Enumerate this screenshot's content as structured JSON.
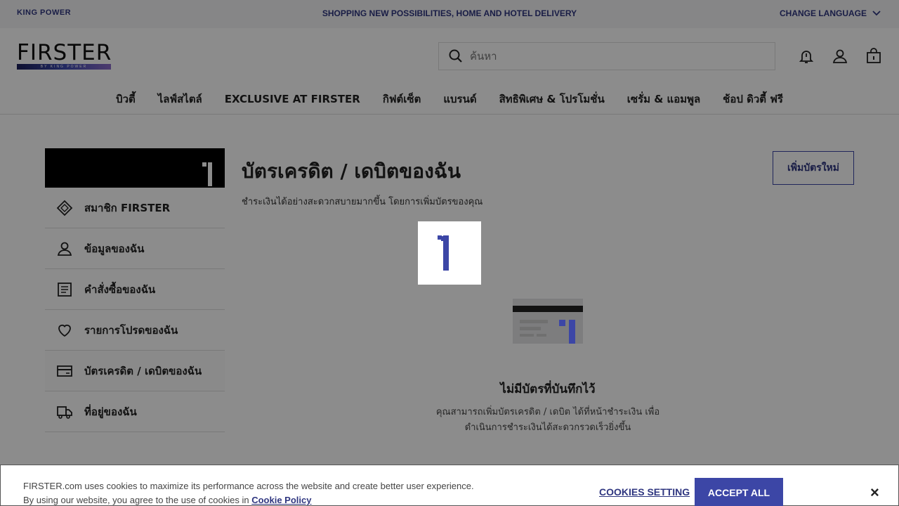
{
  "topbar": {
    "logo": "KING POWER",
    "promo": "SHOPPING NEW POSSIBILITIES, HOME AND HOTEL DELIVERY",
    "language": "CHANGE LANGUAGE"
  },
  "header": {
    "logo": "FIRSTER",
    "logo_sub": "BY KING POWER",
    "search_placeholder": "ค้นหา"
  },
  "nav": [
    "บิวตี้",
    "ไลฟ์สไตล์",
    "EXCLUSIVE AT FIRSTER",
    "กิฟต์เซ็ต",
    "แบรนด์",
    "สิทธิพิเศษ & โปรโมชั่น",
    "เซรั่ม & แอมพูล",
    "ช้อป ดิวตี้ ฟรี"
  ],
  "sidebar": {
    "items": [
      {
        "label": "สมาชิก FIRSTER",
        "icon": "diamond-icon"
      },
      {
        "label": "ข้อมูลของฉัน",
        "icon": "user-icon"
      },
      {
        "label": "คำสั่งซื้อของฉัน",
        "icon": "receipt-icon"
      },
      {
        "label": "รายการโปรดของฉัน",
        "icon": "heart-icon"
      },
      {
        "label": "บัตรเครดิต / เดบิตของฉัน",
        "icon": "card-icon"
      },
      {
        "label": "ที่อยู่ของฉัน",
        "icon": "truck-icon"
      }
    ]
  },
  "main": {
    "title": "บัตรเครดิต / เดบิตของฉัน",
    "subtitle": "ชำระเงินได้อย่างสะดวกสบายมากขึ้น โดยการเพิ่มบัตรของคุณ",
    "add_button": "เพิ่มบัตรใหม่",
    "empty_title": "ไม่มีบัตรที่บันทึกไว้",
    "empty_desc_line1": "คุณสามารถเพิ่มบัตรเครดิต / เดบิต ได้ที่หน้าชำระเงิน เพื่อ",
    "empty_desc_line2": "ดำเนินการชำระเงินได้สะดวกรวดเร็วยิ่งขึ้น"
  },
  "cookie": {
    "line1": "FIRSTER.com uses cookies to maximize its performance across the website and create better user experience.",
    "line2": "By using our website, you agree to the use of cookies in",
    "policy_link": "Cookie Policy",
    "setting": "COOKIES SETTING",
    "accept": "ACCEPT ALL",
    "close": "×"
  },
  "colors": {
    "brand": "#3c46a6",
    "brand_dark": "#2f3680"
  }
}
